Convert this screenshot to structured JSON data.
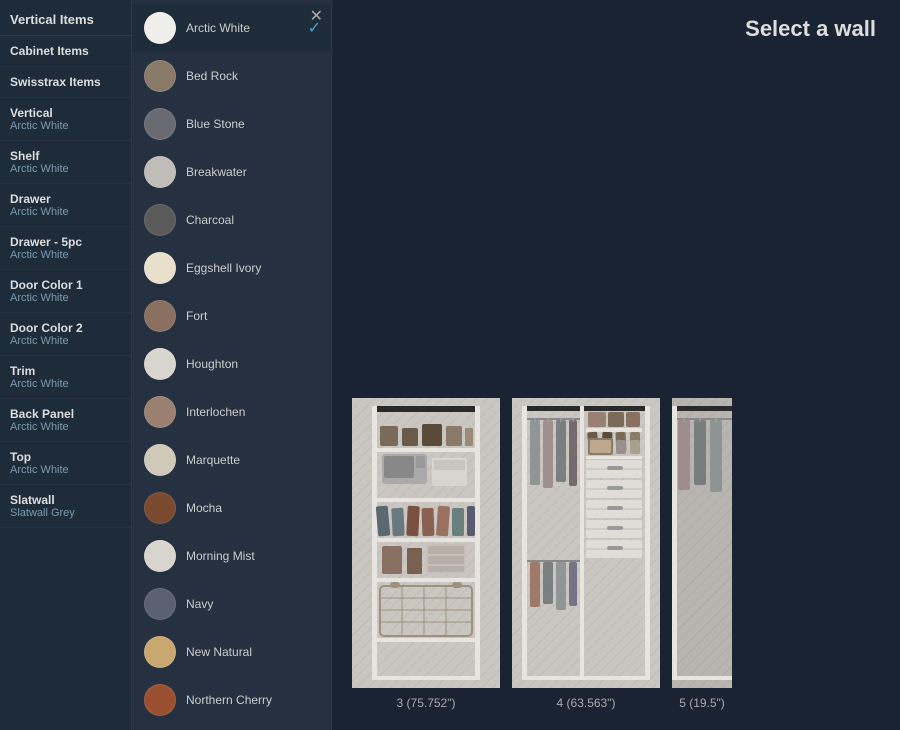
{
  "sidebar": {
    "header": "Vertical Items",
    "sections": [
      {
        "id": "cabinet-items",
        "label": "Cabinet Items",
        "subtitle": ""
      },
      {
        "id": "swisstrax-items",
        "label": "Swisstrax Items",
        "subtitle": ""
      },
      {
        "id": "vertical",
        "label": "Vertical",
        "subtitle": "Arctic White"
      },
      {
        "id": "shelf",
        "label": "Shelf",
        "subtitle": "Arctic White"
      },
      {
        "id": "drawer",
        "label": "Drawer",
        "subtitle": "Arctic White"
      },
      {
        "id": "drawer-5pc",
        "label": "Drawer - 5pc",
        "subtitle": "Arctic White"
      },
      {
        "id": "door-color-1",
        "label": "Door Color 1",
        "subtitle": "Arctic White"
      },
      {
        "id": "door-color-2",
        "label": "Door Color 2",
        "subtitle": "Arctic White"
      },
      {
        "id": "trim",
        "label": "Trim",
        "subtitle": "Arctic White"
      },
      {
        "id": "back-panel",
        "label": "Back Panel",
        "subtitle": "Arctic White"
      },
      {
        "id": "top",
        "label": "Top",
        "subtitle": "Arctic White"
      },
      {
        "id": "slatwall",
        "label": "Slatwall",
        "subtitle": "Slatwall Grey"
      }
    ]
  },
  "colorPanel": {
    "selectedColor": "Arctic White",
    "colors": [
      {
        "id": "arctic-white",
        "name": "Arctic White",
        "swatch": "#f0eeea",
        "selected": true
      },
      {
        "id": "bed-rock",
        "name": "Bed Rock",
        "swatch": "#8a7a6a",
        "selected": false
      },
      {
        "id": "blue-stone",
        "name": "Blue Stone",
        "swatch": "#6a6a72",
        "selected": false
      },
      {
        "id": "breakwater",
        "name": "Breakwater",
        "swatch": "#c0bdb8",
        "selected": false
      },
      {
        "id": "charcoal",
        "name": "Charcoal",
        "swatch": "#5a5a5a",
        "selected": false
      },
      {
        "id": "eggshell-ivory",
        "name": "Eggshell Ivory",
        "swatch": "#e8e0cc",
        "selected": false
      },
      {
        "id": "fort",
        "name": "Fort",
        "swatch": "#8a7060",
        "selected": false
      },
      {
        "id": "houghton",
        "name": "Houghton",
        "swatch": "#d8d4ce",
        "selected": false
      },
      {
        "id": "interlochen",
        "name": "Interlochen",
        "swatch": "#9a8070",
        "selected": false
      },
      {
        "id": "marquette",
        "name": "Marquette",
        "swatch": "#d0c8b8",
        "selected": false
      },
      {
        "id": "mocha",
        "name": "Mocha",
        "swatch": "#7a4a30",
        "selected": false
      },
      {
        "id": "morning-mist",
        "name": "Morning Mist",
        "swatch": "#d8d5ce",
        "selected": false
      },
      {
        "id": "navy",
        "name": "Navy",
        "swatch": "#5a6070",
        "selected": false
      },
      {
        "id": "new-natural",
        "name": "New Natural",
        "swatch": "#c8a870",
        "selected": false
      },
      {
        "id": "northern-cherry",
        "name": "Northern Cherry",
        "swatch": "#9a5030",
        "selected": false
      }
    ]
  },
  "mainHeader": {
    "title": "Select a wall"
  },
  "walls": [
    {
      "id": "wall-3",
      "label": "3 (75.752\")"
    },
    {
      "id": "wall-4",
      "label": "4 (63.563\")"
    },
    {
      "id": "wall-5",
      "label": "5 (19.5\")"
    }
  ]
}
